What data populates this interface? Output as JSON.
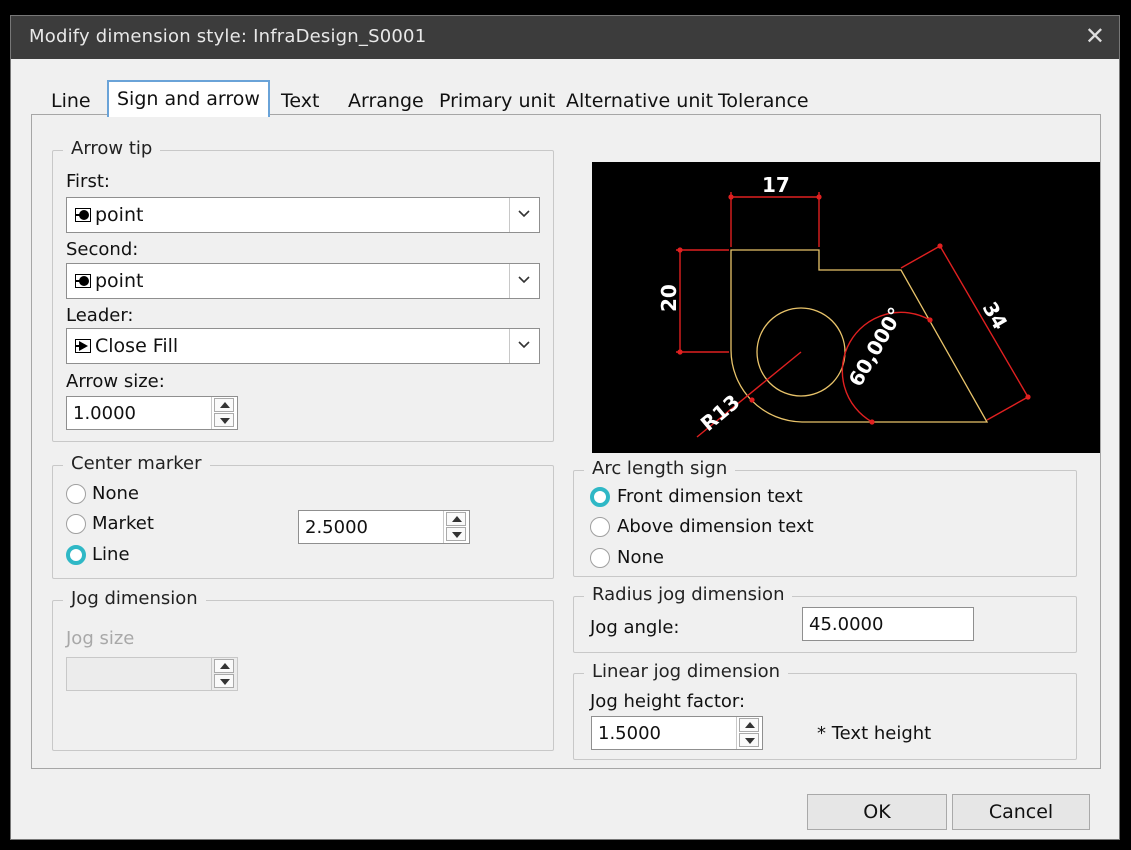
{
  "window": {
    "title": "Modify dimension style: InfraDesign_S0001",
    "close_glyph": "✕"
  },
  "tabs": [
    {
      "label": "Line"
    },
    {
      "label": "Sign and arrow"
    },
    {
      "label": "Text"
    },
    {
      "label": "Arrange"
    },
    {
      "label": "Primary unit"
    },
    {
      "label": "Alternative unit"
    },
    {
      "label": "Tolerance"
    }
  ],
  "active_tab": "Sign and arrow",
  "arrow_tip": {
    "legend": "Arrow tip",
    "first_label": "First:",
    "first_value": "point",
    "first_icon": "dot-arrow-icon",
    "second_label": "Second:",
    "second_value": "point",
    "second_icon": "dot-arrow-icon",
    "leader_label": "Leader:",
    "leader_value": "Close Fill",
    "leader_icon": "closed-fill-arrow-icon",
    "size_label": "Arrow size:",
    "size_value": "1.0000"
  },
  "center_marker": {
    "legend": "Center marker",
    "options": [
      {
        "label": "None",
        "selected": false
      },
      {
        "label": "Market",
        "selected": false
      },
      {
        "label": "Line",
        "selected": true
      }
    ],
    "size_value": "2.5000"
  },
  "jog_dimension": {
    "legend": "Jog dimension",
    "size_label": "Jog size",
    "size_value": ""
  },
  "preview": {
    "dim_top": "17",
    "dim_left": "20",
    "dim_angle": "60,000°",
    "dim_slant": "34",
    "dim_radius": "R13",
    "colors": {
      "background": "#000000",
      "geometry": "#e8c36a",
      "dimension": "#e02020",
      "text": "#ffffff"
    }
  },
  "arc_length_sign": {
    "legend": "Arc length sign",
    "options": [
      {
        "label": "Front dimension text",
        "selected": true
      },
      {
        "label": "Above dimension text",
        "selected": false
      },
      {
        "label": "None",
        "selected": false
      }
    ]
  },
  "radius_jog": {
    "legend": "Radius jog dimension",
    "angle_label": "Jog angle:",
    "angle_value": "45.0000"
  },
  "linear_jog": {
    "legend": "Linear jog dimension",
    "factor_label": "Jog height factor:",
    "factor_value": "1.5000",
    "note": "* Text height"
  },
  "buttons": {
    "ok": "OK",
    "cancel": "Cancel"
  },
  "colors": {
    "title_bar": "#3c3c3c",
    "accent": "#2fb8c6",
    "tab_border": "#6aa3d8",
    "dialog_bg": "#f0f0f0"
  }
}
